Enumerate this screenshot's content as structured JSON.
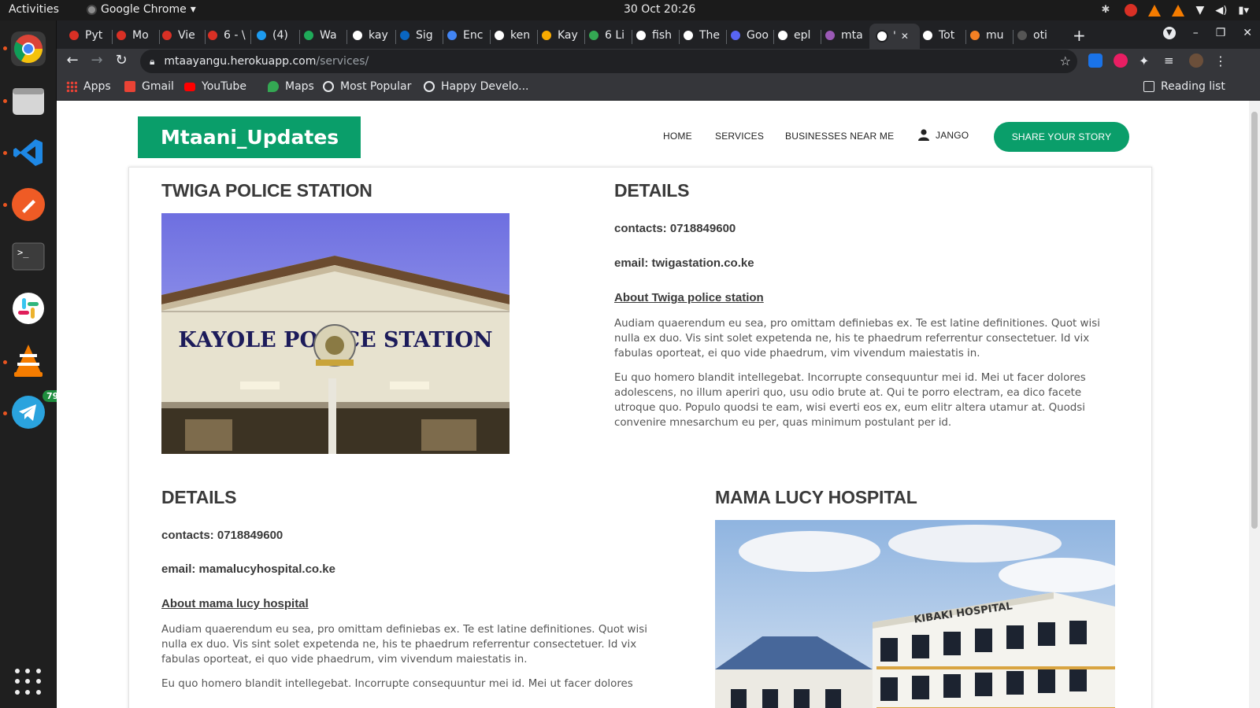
{
  "system": {
    "activities": "Activities",
    "app_name": "Google Chrome",
    "clock": "30 Oct  20:26"
  },
  "dock": {
    "telegram_badge": "79"
  },
  "browser": {
    "tabs": [
      {
        "label": "Pyt",
        "favicon_color": "#d93025"
      },
      {
        "label": "Mo",
        "favicon_color": "#d93025"
      },
      {
        "label": "Vie",
        "favicon_color": "#d93025"
      },
      {
        "label": "6 - \\",
        "favicon_color": "#d93025"
      },
      {
        "label": "(4)",
        "favicon_color": "#1d9bf0"
      },
      {
        "label": "Wa",
        "favicon_color": "#1faa59"
      },
      {
        "label": "kay",
        "favicon_color": "#ffffff"
      },
      {
        "label": "Sig",
        "favicon_color": "#0a66c2"
      },
      {
        "label": "Enc",
        "favicon_color": "#4285f4"
      },
      {
        "label": "ken",
        "favicon_color": "#ffffff"
      },
      {
        "label": "Kay",
        "favicon_color": "#f9ab00"
      },
      {
        "label": "6 Li",
        "favicon_color": "#34a853"
      },
      {
        "label": "fish",
        "favicon_color": "#ffffff"
      },
      {
        "label": "The",
        "favicon_color": "#ffffff"
      },
      {
        "label": "Goo",
        "favicon_color": "#5865f2"
      },
      {
        "label": "epl",
        "favicon_color": "#ffffff"
      },
      {
        "label": "mta",
        "favicon_color": "#9b59b6"
      },
      {
        "label": "'",
        "favicon_color": "#ffffff"
      },
      {
        "label": "Tot",
        "favicon_color": "#ffffff"
      },
      {
        "label": "mu",
        "favicon_color": "#f48024"
      },
      {
        "label": "oti",
        "favicon_color": "#555555"
      }
    ],
    "active_tab_index": 17,
    "new_tab": "+",
    "url_host": "mtaayangu.herokuapp.com",
    "url_path": "/services/",
    "bookmarks": [
      {
        "label": "Apps",
        "icon": "apps-grid-icon",
        "color": "#e94235"
      },
      {
        "label": "Gmail",
        "icon": "gmail-icon",
        "color": "#ea4335"
      },
      {
        "label": "YouTube",
        "icon": "youtube-icon",
        "color": "#ff0000"
      },
      {
        "label": "Maps",
        "icon": "maps-pin-icon",
        "color": "#34a853"
      },
      {
        "label": "Most Popular",
        "icon": "globe-icon",
        "color": "#e8eaed"
      },
      {
        "label": "Happy Develo...",
        "icon": "globe-icon",
        "color": "#e8eaed"
      }
    ],
    "reading_list": "Reading list"
  },
  "site": {
    "brand": "Mtaani_Updates",
    "brand_color": "#0a9e6a",
    "nav": {
      "home": "HOME",
      "services": "SERVICES",
      "businesses": "BUSINESSES NEAR ME",
      "user": "JANGO",
      "share": "SHARE YOUR STORY"
    },
    "services": [
      {
        "title": "TWIGA POLICE STATION",
        "photo_sign": "KAYOLE POLICE STATION",
        "details_heading": "DETAILS",
        "contacts": "contacts: 0718849600",
        "email": "email: twigastation.co.ke",
        "about": "About Twiga police station",
        "para1": "Audiam quaerendum eu sea, pro omittam definiebas ex. Te est latine definitiones. Quot wisi nulla ex duo. Vis sint solet expetenda ne, his te phaedrum referrentur consectetuer. Id vix fabulas oporteat, ei quo vide phaedrum, vim vivendum maiestatis in.",
        "para2": "Eu quo homero blandit intellegebat. Incorrupte consequuntur mei id. Mei ut facer dolores adolescens, no illum aperiri quo, usu odio brute at. Qui te porro electram, ea dico facete utroque quo. Populo quodsi te eam, wisi everti eos ex, eum elitr altera utamur at. Quodsi convenire mnesarchum eu per, quas minimum postulant per id."
      },
      {
        "title": "MAMA LUCY HOSPITAL",
        "photo_sign": "KIBAKI HOSPITAL",
        "details_heading": "DETAILS",
        "contacts": "contacts: 0718849600",
        "email": "email: mamalucyhospital.co.ke",
        "about": "About mama lucy hospital",
        "para1": "Audiam quaerendum eu sea, pro omittam definiebas ex. Te est latine definitiones. Quot wisi nulla ex duo. Vis sint solet expetenda ne, his te phaedrum referrentur consectetuer. Id vix fabulas oporteat, ei quo vide phaedrum, vim vivendum maiestatis in.",
        "para2": "Eu quo homero blandit intellegebat. Incorrupte consequuntur mei id. Mei ut facer dolores"
      }
    ]
  }
}
